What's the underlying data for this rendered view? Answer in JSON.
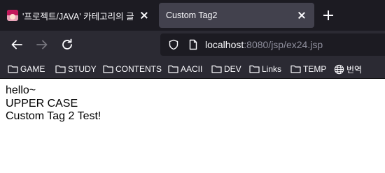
{
  "tabs": [
    {
      "title": "'프로젝트/JAVA' 카테고리의 글",
      "active": false,
      "favicon": "anime-avatar-icon"
    },
    {
      "title": "Custom Tag2",
      "active": true
    }
  ],
  "navbar": {
    "url_host": "localhost",
    "url_rest": ":8080/jsp/ex24.jsp"
  },
  "bookmarks": [
    {
      "label": "GAME",
      "icon": "folder-icon"
    },
    {
      "label": "STUDY",
      "icon": "folder-icon"
    },
    {
      "label": "CONTENTS",
      "icon": "folder-icon"
    },
    {
      "label": "AACII",
      "icon": "folder-icon"
    },
    {
      "label": "DEV",
      "icon": "folder-icon"
    },
    {
      "label": "Links",
      "icon": "folder-icon"
    },
    {
      "label": "TEMP",
      "icon": "folder-icon"
    },
    {
      "label": "번역",
      "icon": "globe-icon"
    }
  ],
  "page": {
    "lines": [
      "hello~",
      "UPPER CASE",
      "Custom Tag 2 Test!"
    ]
  },
  "colors": {
    "chrome_dark": "#1c1b22",
    "toolbar": "#2b2a33",
    "active_tab": "#42414d",
    "text_light": "#fbfbfe",
    "url_dim": "#8f8f9d"
  }
}
